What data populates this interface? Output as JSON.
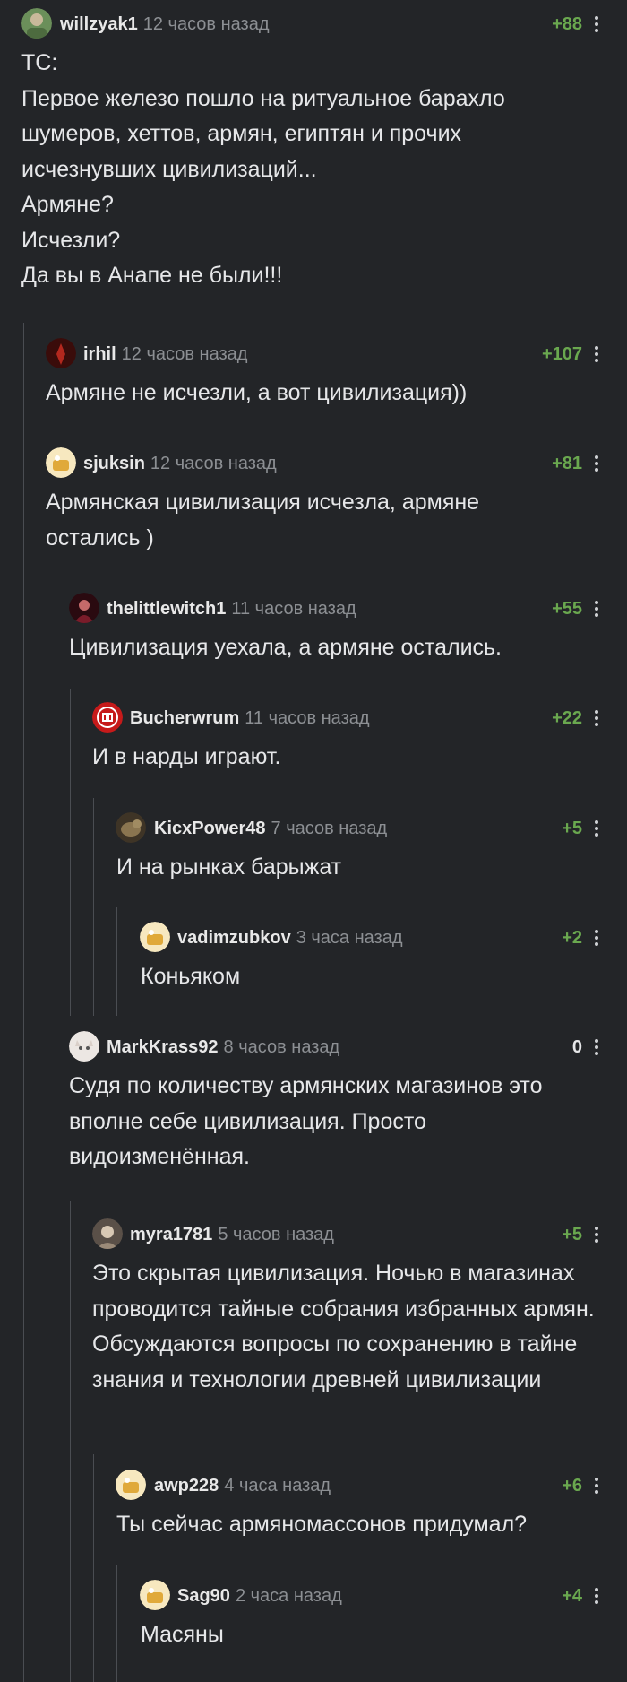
{
  "comments": [
    {
      "id": "c1",
      "user": "willzyak1",
      "time": "12 часов назад",
      "rating": "+88",
      "text": "ТС:\nПервое железо пошло на ритуальное барахло шумеров, хеттов, армян, египтян и прочих исчезнувших цивилизаций...\nАрмяне?\nИсчезли?\nДа вы в Анапе не были!!!",
      "avatar_color": "#6b8f5a"
    },
    {
      "id": "c2",
      "user": "irhil",
      "time": "12 часов назад",
      "rating": "+107",
      "text": "Армяне не исчезли, а вот цивилизация))",
      "avatar_color": "#7a1a14"
    },
    {
      "id": "c3",
      "user": "sjuksin",
      "time": "12 часов назад",
      "rating": "+81",
      "text": "Армянская цивилизация исчезла, армяне остались )",
      "avatar_color": "#f2dca0"
    },
    {
      "id": "c4",
      "user": "thelittlewitch1",
      "time": "11 часов назад",
      "rating": "+55",
      "text": "Цивилизация уехала, а армяне остались.",
      "avatar_color": "#5a1a24"
    },
    {
      "id": "c5",
      "user": "Bucherwrum",
      "time": "11 часов назад",
      "rating": "+22",
      "text": "И в нарды играют.",
      "avatar_color": "#d02020"
    },
    {
      "id": "c6",
      "user": "KicxPower48",
      "time": "7 часов назад",
      "rating": "+5",
      "text": "И на рынках барыжат",
      "avatar_color": "#6b5a3a"
    },
    {
      "id": "c7",
      "user": "vadimzubkov",
      "time": "3 часа назад",
      "rating": "+2",
      "text": "Коньяком",
      "avatar_color": "#f2dca0"
    },
    {
      "id": "c8",
      "user": "MarkKrass92",
      "time": "8 часов назад",
      "rating": "0",
      "text": "Судя по количеству армянских магазинов это вполне себе цивилизация. Просто видоизменённая.",
      "avatar_color": "#e8e2de"
    },
    {
      "id": "c9",
      "user": "myra1781",
      "time": "5 часов назад",
      "rating": "+5",
      "text": "Это скрытая цивилизация. Ночью в магазинах проводится тайные собрания избранных армян. Обсуждаются вопросы по сохранению в тайне знания и технологии древней цивилизации",
      "avatar_color": "#8a7a6a"
    },
    {
      "id": "c10",
      "user": "awp228",
      "time": "4 часа назад",
      "rating": "+6",
      "text": "Ты сейчас армяномассонов придумал?",
      "avatar_color": "#f2dca0"
    },
    {
      "id": "c11",
      "user": "Sag90",
      "time": "2 часа назад",
      "rating": "+4",
      "text": "Масяны",
      "avatar_color": "#f2dca0"
    }
  ],
  "colors": {
    "background": "#232528",
    "positive": "#6aa84f",
    "muted": "#8c8f93"
  },
  "icons": {
    "more": "more-vertical-icon",
    "avatar": "avatar"
  }
}
